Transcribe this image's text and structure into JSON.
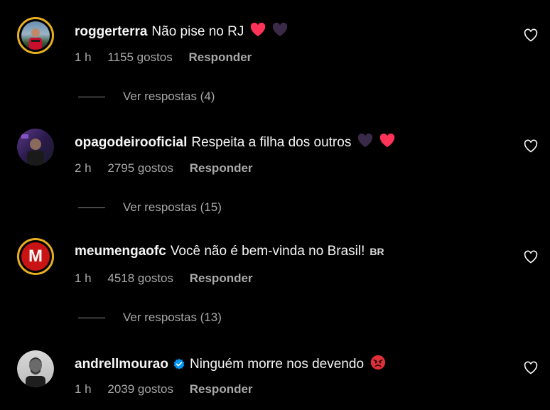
{
  "comments": [
    {
      "username": "roggerterra",
      "text": "Não pise no RJ",
      "emojis": [
        "red-heart",
        "black-heart"
      ],
      "time": "1 h",
      "likes": "1155 gostos",
      "reply": "Responder",
      "view_replies": "Ver respostas (4)",
      "avatar": "photo-avatar-ring",
      "colors": {
        "ring": "#e8b020"
      }
    },
    {
      "username": "opagodeirooficial",
      "text": "Respeita a filha dos outros",
      "emojis": [
        "black-heart",
        "red-heart"
      ],
      "time": "2 h",
      "likes": "2795 gostos",
      "reply": "Responder",
      "view_replies": "Ver respostas (15)",
      "avatar": "photo-avatar"
    },
    {
      "username": "meumengaofc",
      "text": "Você não é bem-vinda no Brasil!",
      "flag": "BR",
      "time": "1 h",
      "likes": "4518 gostos",
      "reply": "Responder",
      "view_replies": "Ver respostas (13)",
      "avatar": "letter-m-avatar",
      "avatar_letter": "M",
      "colors": {
        "avatar_bg": "#c81414",
        "ring": "#e8b020"
      }
    },
    {
      "username": "andrellmourao",
      "verified": true,
      "text": "Ninguém morre nos devendo",
      "emojis": [
        "angry-face"
      ],
      "time": "1 h",
      "likes": "2039 gostos",
      "reply": "Responder",
      "avatar": "photo-avatar-grayscale",
      "colors": {
        "verified": "#0095f6"
      }
    }
  ],
  "colors": {
    "background": "#000000",
    "text_primary": "#f5f5f5",
    "text_secondary": "#a8a8a8",
    "heart_red": "#ff3040"
  }
}
